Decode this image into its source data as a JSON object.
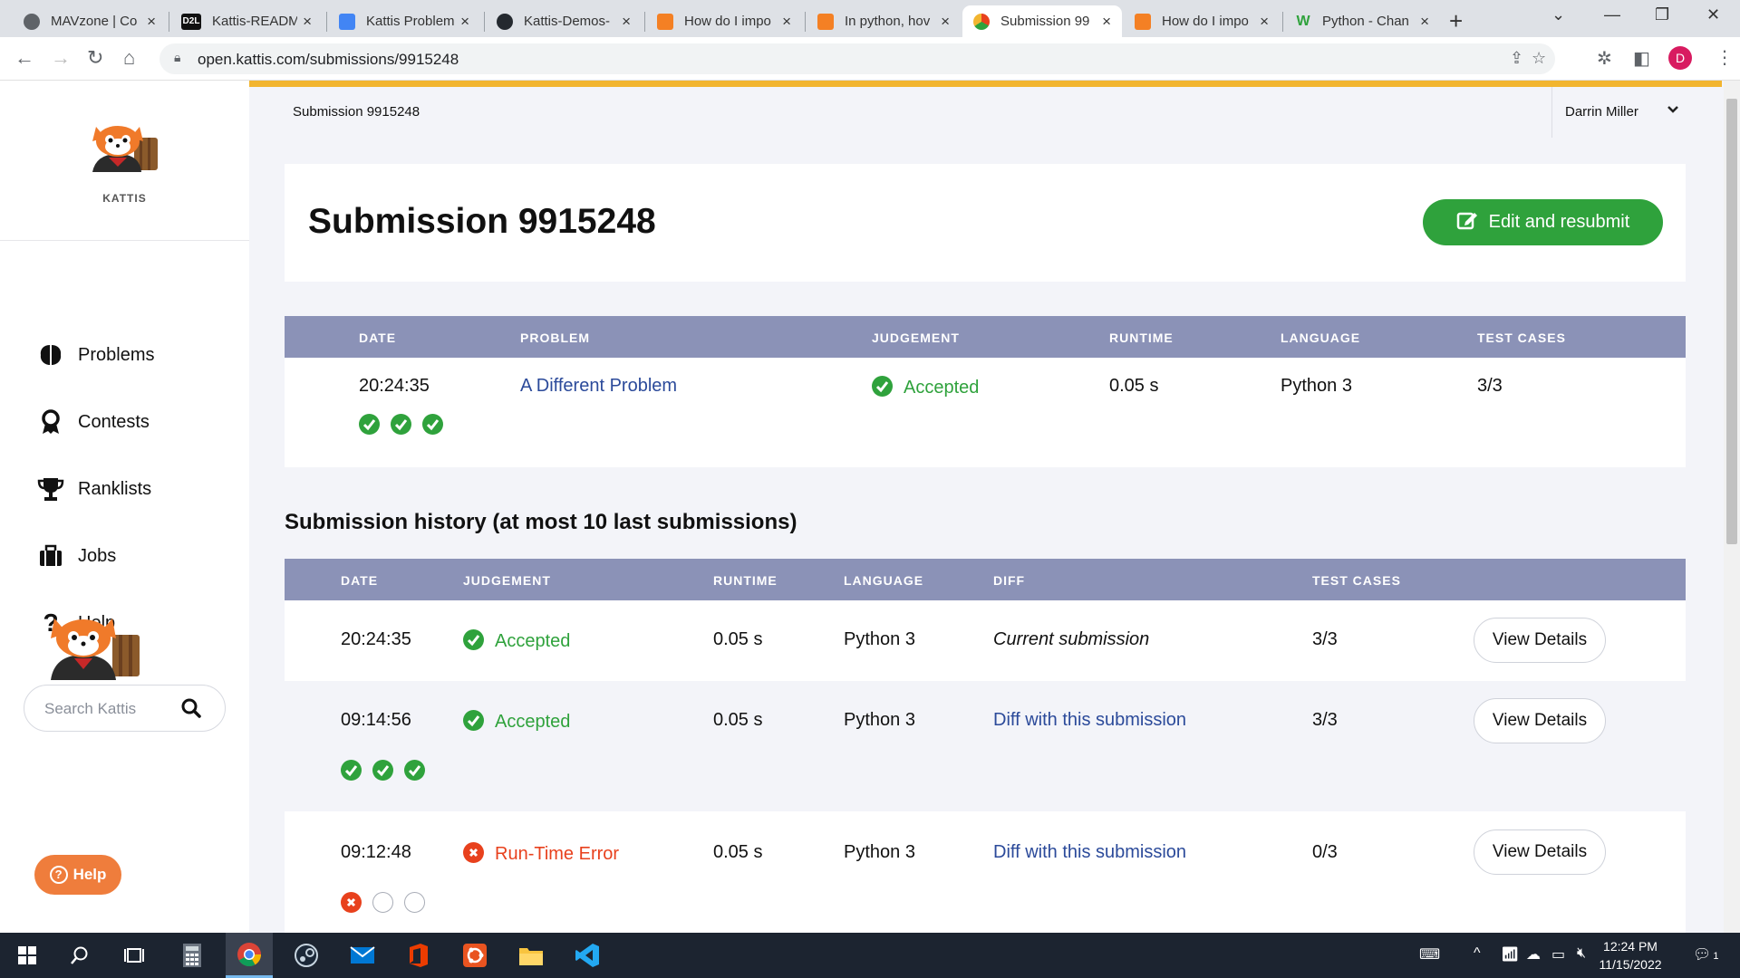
{
  "browser": {
    "tabs": [
      {
        "title": "MAVzone | Co",
        "favicon_color": "#5f6368",
        "favicon_text": ""
      },
      {
        "title": "Kattis-READM",
        "favicon_color": "#111111",
        "favicon_text": "D2L"
      },
      {
        "title": "Kattis Problem",
        "favicon_color": "#4285f4",
        "favicon_text": ""
      },
      {
        "title": "Kattis-Demos-",
        "favicon_color": "#24292f",
        "favicon_text": ""
      },
      {
        "title": "How do I impo",
        "favicon_color": "#f48024",
        "favicon_text": ""
      },
      {
        "title": "In python, hov",
        "favicon_color": "#f48024",
        "favicon_text": ""
      },
      {
        "title": "Submission 99",
        "favicon_color": "#e5a234",
        "favicon_text": ""
      },
      {
        "title": "How do I impo",
        "favicon_color": "#f48024",
        "favicon_text": ""
      },
      {
        "title": "Python - Chan",
        "favicon_color": "#ffffff",
        "favicon_text": "W"
      }
    ],
    "close_glyph": "×",
    "new_tab_glyph": "+",
    "url": "open.kattis.com/submissions/9915248",
    "profile_initial": "D"
  },
  "sidebar": {
    "logo_text": "KATTIS",
    "nav": [
      {
        "label": "Problems",
        "icon": "brain-icon"
      },
      {
        "label": "Contests",
        "icon": "award-icon"
      },
      {
        "label": "Ranklists",
        "icon": "trophy-icon"
      },
      {
        "label": "Jobs",
        "icon": "briefcase-icon"
      },
      {
        "label": "Help",
        "icon": "question-icon"
      }
    ],
    "search_placeholder": "Search Kattis",
    "help_button": "Help"
  },
  "topbar": {
    "breadcrumb": "Submission 9915248",
    "user": "Darrin Miller"
  },
  "submission": {
    "title": "Submission 9915248",
    "edit_button": "Edit and resubmit",
    "headers": [
      "DATE",
      "PROBLEM",
      "JUDGEMENT",
      "RUNTIME",
      "LANGUAGE",
      "TEST CASES"
    ],
    "date": "20:24:35",
    "problem": "A Different Problem",
    "judgement": "Accepted",
    "runtime": "0.05 s",
    "language": "Python 3",
    "test_cases": "3/3",
    "test_results": [
      "ok",
      "ok",
      "ok"
    ]
  },
  "history": {
    "title": "Submission history (at most 10 last submissions)",
    "headers": [
      "DATE",
      "JUDGEMENT",
      "RUNTIME",
      "LANGUAGE",
      "DIFF",
      "TEST CASES"
    ],
    "view_details_label": "View Details",
    "rows": [
      {
        "date": "20:24:35",
        "judgement": "Accepted",
        "status": "ok",
        "runtime": "0.05 s",
        "language": "Python 3",
        "diff": "Current submission",
        "test_cases": "3/3",
        "test_results": []
      },
      {
        "date": "09:14:56",
        "judgement": "Accepted",
        "status": "ok",
        "runtime": "0.05 s",
        "language": "Python 3",
        "diff": "Diff with this submission",
        "test_cases": "3/3",
        "test_results": [
          "ok",
          "ok",
          "ok"
        ]
      },
      {
        "date": "09:12:48",
        "judgement": "Run-Time Error",
        "status": "bad",
        "runtime": "0.05 s",
        "language": "Python 3",
        "diff": "Diff with this submission",
        "test_cases": "0/3",
        "test_results": [
          "bad",
          "empty",
          "empty"
        ]
      }
    ]
  },
  "taskbar": {
    "time": "12:24 PM",
    "date": "11/15/2022",
    "notification_count": "1"
  },
  "colors": {
    "accent_gold": "#f2b530",
    "table_header": "#8b92b7",
    "accepted_green": "#2fa23c",
    "error_red": "#e8411d",
    "link_blue": "#2b4a9a",
    "help_orange": "#ef7d3c"
  }
}
